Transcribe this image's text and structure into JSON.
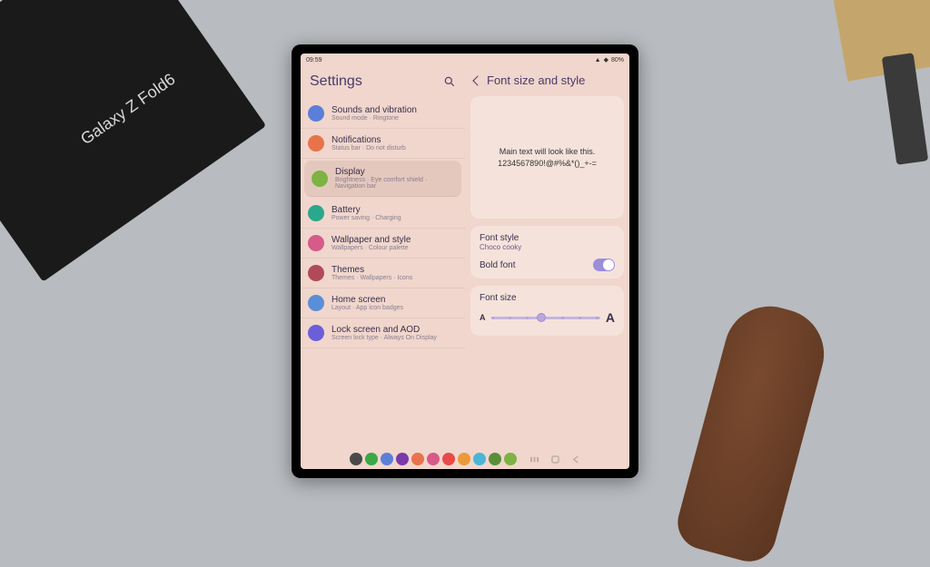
{
  "box": {
    "product_name": "Galaxy Z Fold6"
  },
  "status": {
    "time": "09:59",
    "battery": "80%"
  },
  "left": {
    "title": "Settings",
    "items": [
      {
        "name": "Sounds and vibration",
        "sub": "Sound mode · Ringtone",
        "color": "#5b7ed8"
      },
      {
        "name": "Notifications",
        "sub": "Status bar · Do not disturb",
        "color": "#e8734a"
      },
      {
        "name": "Display",
        "sub": "Brightness · Eye comfort shield · Navigation bar",
        "color": "#7cb342",
        "selected": true
      },
      {
        "name": "Battery",
        "sub": "Power saving · Charging",
        "color": "#2aa88c"
      },
      {
        "name": "Wallpaper and style",
        "sub": "Wallpapers · Colour palette",
        "color": "#d65a8a"
      },
      {
        "name": "Themes",
        "sub": "Themes · Wallpapers · Icons",
        "color": "#b04a5a"
      },
      {
        "name": "Home screen",
        "sub": "Layout · App icon badges",
        "color": "#5b8ed8"
      },
      {
        "name": "Lock screen and AOD",
        "sub": "Screen lock type · Always On Display",
        "color": "#6a5fd8"
      }
    ]
  },
  "right": {
    "title": "Font size and style",
    "preview_line1": "Main text will look like this.",
    "preview_line2": "1234567890!@#%&*()_+-=",
    "font_style_label": "Font style",
    "font_style_value": "Choco cooky",
    "bold_label": "Bold font",
    "bold_on": true,
    "size_label": "Font size"
  },
  "taskbar_colors": [
    "#4a4a4a",
    "#3aa845",
    "#5b7ed8",
    "#7a3aa8",
    "#e8734a",
    "#d65a8a",
    "#e84a4a",
    "#e89a3a",
    "#4ab5d8",
    "#5a8e3a",
    "#7cb342"
  ]
}
